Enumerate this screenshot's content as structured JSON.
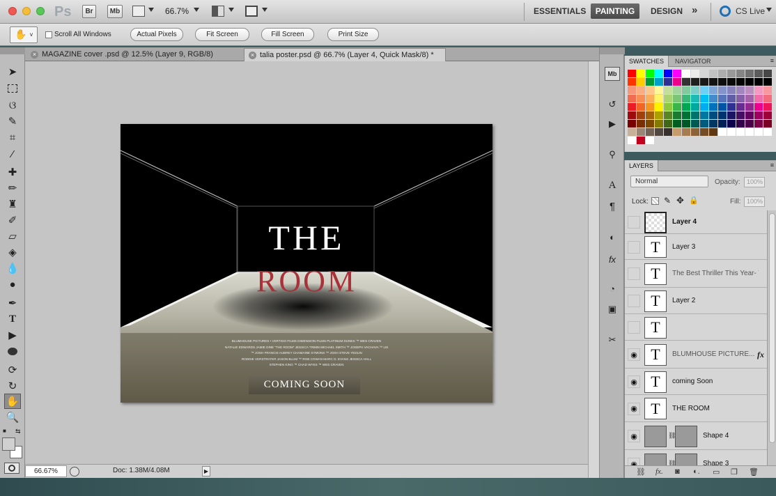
{
  "menubar": {
    "app_logo": "Ps",
    "btn_br": "Br",
    "btn_mb": "Mb",
    "zoom": "66.7%",
    "workspaces": [
      "ESSENTIALS",
      "PAINTING",
      "DESIGN"
    ],
    "more": "»",
    "cslive": "CS Live",
    "icons": [
      "view-extras-icon",
      "arrange-documents-icon",
      "screen-mode-icon"
    ]
  },
  "options": {
    "scroll_all": "Scroll All Windows",
    "actual_pixels": "Actual Pixels",
    "fit_screen": "Fit Screen",
    "fill_screen": "Fill Screen",
    "print_size": "Print Size"
  },
  "tabs": [
    {
      "label": "MAGAZINE cover .psd @ 12.5% (Layer 9, RGB/8)"
    },
    {
      "label": "talia poster.psd @ 66.7% (Layer 4, Quick Mask/8) *"
    }
  ],
  "poster": {
    "title_the": "THE",
    "title_room": "ROOM",
    "credits": [
      "BLUMHOUSE PICTURES • VERTIGO FILMS DIMENSION FILMS PLATINUM DUNES ™ WES CRAVEN",
      "NATALIE EDWARDS JAMIE DINE \"THE ROOM\" JESSICA TRIMM MICHAEL SMITH ™ JOSEPH VACHAVA ™ LEE PERCY",
      "™ JOSH FRANCIS AUBREY CHAMAINE SYMONS ™ JOSH STEVE YEDLIN",
      "RODDIE VERSTRATER JASON BLUM ™ ROB COWAN MARC D. EVANS JESSICA HALL",
      "STEPHEN KING ™ CHAD WYES ™ WES CRAVEN"
    ],
    "coming_soon": "COMING SOON"
  },
  "status": {
    "zoom": "66.67%",
    "doc": "Doc: 1.38M/4.08M"
  },
  "swatches": {
    "tab_swatches": "SWATCHES",
    "tab_navigator": "NAVIGATOR",
    "rows": [
      [
        "#ff0000",
        "#ffff00",
        "#00ff00",
        "#00ffff",
        "#0000ff",
        "#ff00ff",
        "#ffffff",
        "#ebebeb",
        "#d6d6d6",
        "#c2c2c2",
        "#adadad",
        "#999999",
        "#858585",
        "#707070",
        "#5c5c5c",
        "#474747"
      ],
      [
        "#ff3300",
        "#ffcc00",
        "#009933",
        "#00a0c8",
        "#2e3192",
        "#ec008c",
        "#333333",
        "#1f1f1f",
        "#1a1a1a",
        "#141414",
        "#0f0f0f",
        "#0a0a0a",
        "#050505",
        "#000000",
        "#000000",
        "#000000"
      ],
      [
        "#f7977a",
        "#f9ad81",
        "#fdc68a",
        "#fff79a",
        "#c4df9b",
        "#a2d39c",
        "#82ca9d",
        "#7bcdc8",
        "#6ecff6",
        "#7ea7d8",
        "#8493ca",
        "#8882be",
        "#a187be",
        "#bc8dbf",
        "#f49ac2",
        "#f6989d"
      ],
      [
        "#f26c4f",
        "#f68e55",
        "#fbaf5c",
        "#fff467",
        "#acd372",
        "#7cc576",
        "#3bb878",
        "#1abbb4",
        "#00bff3",
        "#438ccb",
        "#5574b9",
        "#605ca8",
        "#855fa8",
        "#a763a8",
        "#f06ea9",
        "#f26d7d"
      ],
      [
        "#ed1c24",
        "#f26522",
        "#f7941d",
        "#fff200",
        "#8dc73f",
        "#39b54a",
        "#00a651",
        "#00a99d",
        "#00aeef",
        "#0072bc",
        "#0054a6",
        "#2e3192",
        "#662d91",
        "#92278f",
        "#ec008c",
        "#ed145b"
      ],
      [
        "#9e0b0f",
        "#a0410d",
        "#a3620a",
        "#aba000",
        "#598527",
        "#1a7b30",
        "#007236",
        "#00746b",
        "#0076a3",
        "#004b80",
        "#003471",
        "#1b1464",
        "#440e62",
        "#630460",
        "#9e005d",
        "#9e0039"
      ],
      [
        "#790000",
        "#7b2e00",
        "#7d4900",
        "#827b00",
        "#406618",
        "#005e20",
        "#005826",
        "#005952",
        "#005b7f",
        "#003663",
        "#002157",
        "#0d004c",
        "#32004b",
        "#4b0049",
        "#7b0046",
        "#7a0026"
      ],
      [
        "#c7b299",
        "#998675",
        "#736357",
        "#534741",
        "#37302d",
        "#c69c6d",
        "#a67c52",
        "#8c6239",
        "#754c24",
        "#603913",
        "#ffffff",
        "#ffffff",
        "#ffffff",
        "#ffffff",
        "#ffffff",
        "#ffffff"
      ],
      [
        "#ffffff",
        "#c1001f",
        "#ffffff",
        "#d6d6d6",
        "#d6d6d6",
        "#d6d6d6",
        "#d6d6d6",
        "#d6d6d6",
        "#d6d6d6",
        "#d6d6d6",
        "#d6d6d6",
        "#d6d6d6",
        "#d6d6d6",
        "#d6d6d6",
        "#d6d6d6",
        "#d6d6d6"
      ]
    ]
  },
  "layers": {
    "tab": "LAYERS",
    "blend_mode": "Normal",
    "opacity_label": "Opacity:",
    "opacity": "100%",
    "lock_label": "Lock:",
    "fill_label": "Fill:",
    "fill": "100%",
    "items": [
      {
        "name": "Layer 4",
        "type": "pixel",
        "visible": false
      },
      {
        "name": "Layer 3",
        "type": "text",
        "visible": false
      },
      {
        "name": "The Best Thriller This Year- Th...",
        "type": "text",
        "visible": false
      },
      {
        "name": "Layer 2",
        "type": "text",
        "visible": false
      },
      {
        "name": "",
        "type": "text",
        "visible": false
      },
      {
        "name": "BLUMHOUSE PICTURE...",
        "type": "text",
        "visible": true,
        "fx": "fx"
      },
      {
        "name": "coming Soon",
        "type": "text",
        "visible": true
      },
      {
        "name": "THE     ROOM",
        "type": "text",
        "visible": true
      },
      {
        "name": "Shape 4",
        "type": "shape",
        "visible": true
      },
      {
        "name": "Shape 3",
        "type": "shape",
        "visible": true
      }
    ]
  },
  "colors": {
    "title_red": "#a8323a",
    "accent_active": "#4f4f4f"
  }
}
